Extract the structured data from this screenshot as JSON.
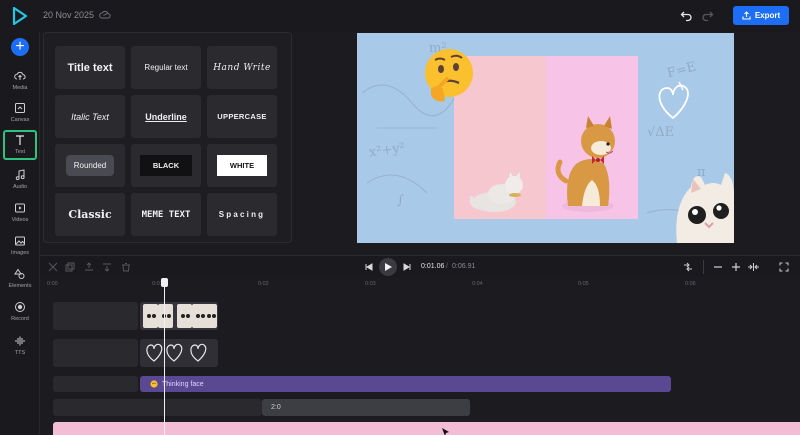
{
  "header": {
    "date": "20 Nov 2025",
    "export_label": "Export",
    "accent": "#1e6ef5"
  },
  "rail": {
    "add_icon": "plus-icon",
    "items": [
      {
        "label": "Media",
        "icon": "cloud-upload-icon"
      },
      {
        "label": "Canvas",
        "icon": "canvas-icon"
      },
      {
        "label": "Text",
        "icon": "text-icon",
        "active": true
      },
      {
        "label": "Audio",
        "icon": "music-note-icon"
      },
      {
        "label": "Videos",
        "icon": "video-icon"
      },
      {
        "label": "Images",
        "icon": "image-icon"
      },
      {
        "label": "Elements",
        "icon": "shapes-icon"
      },
      {
        "label": "Record",
        "icon": "record-icon"
      },
      {
        "label": "TTS",
        "icon": "waveform-icon"
      }
    ],
    "active_color": "#2ec27e"
  },
  "text_panel": {
    "styles": [
      "Title text",
      "Regular text",
      "Hand Write",
      "Italic Text",
      "Underline",
      "UPPERCASE",
      "Rounded",
      "BLACK",
      "WHITE",
      "Classic",
      "MEME TEXT",
      "Spacing"
    ]
  },
  "canvas": {
    "background": "#a9c9e8",
    "scribbles": [
      "m²",
      "F=E",
      "√ΔE",
      "x²+y²",
      "∫",
      "π"
    ],
    "elements": [
      "thinking-face-emoji",
      "cat-photo",
      "shiba-dog-photo",
      "heart-doodle",
      "cat-meme-sticker"
    ]
  },
  "timeline": {
    "current_time": "0:01.06",
    "total_time": "0:06.91",
    "ruler_ticks": [
      "0:00",
      "0:01",
      "0:02",
      "0:03",
      "0:04",
      "0:05",
      "0:06"
    ],
    "clips": {
      "thinking": "Thinking face",
      "gray": "2:0"
    }
  }
}
